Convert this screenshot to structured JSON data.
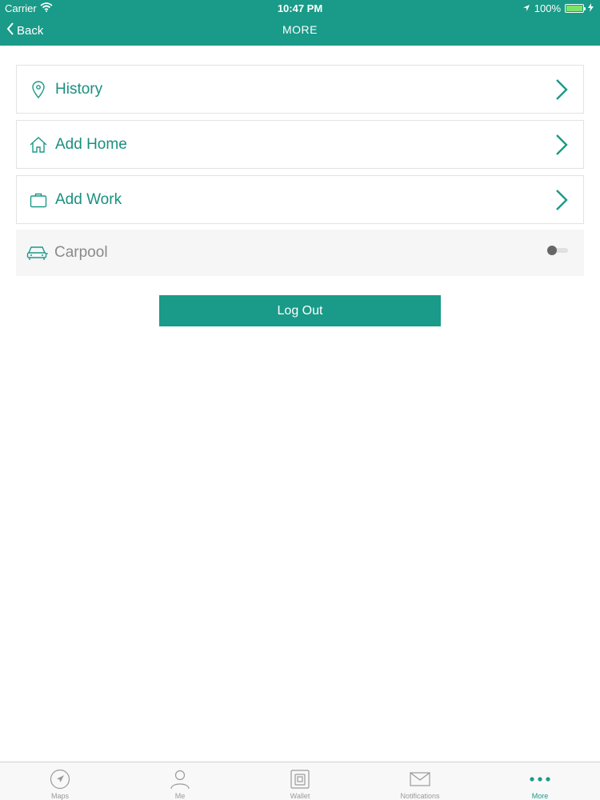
{
  "status_bar": {
    "carrier": "Carrier",
    "time": "10:47 PM",
    "battery": "100%"
  },
  "nav": {
    "back_label": "Back",
    "title": "MORE"
  },
  "menu": [
    {
      "label": "History",
      "icon": "location-pin-icon"
    },
    {
      "label": "Add Home",
      "icon": "home-icon"
    },
    {
      "label": "Add Work",
      "icon": "briefcase-icon"
    }
  ],
  "carpool": {
    "label": "Carpool",
    "icon": "car-icon",
    "enabled": false
  },
  "logout_label": "Log Out",
  "tabs": [
    {
      "label": "Maps",
      "icon": "compass-arrow-icon",
      "active": false
    },
    {
      "label": "Me",
      "icon": "person-icon",
      "active": false
    },
    {
      "label": "Wallet",
      "icon": "wallet-icon",
      "active": false
    },
    {
      "label": "Notifications",
      "icon": "envelope-icon",
      "active": false
    },
    {
      "label": "More",
      "icon": "more-dots-icon",
      "active": true
    }
  ],
  "colors": {
    "accent": "#1a9a88",
    "text_teal": "#1a8f80",
    "muted": "#8a8a8a"
  }
}
